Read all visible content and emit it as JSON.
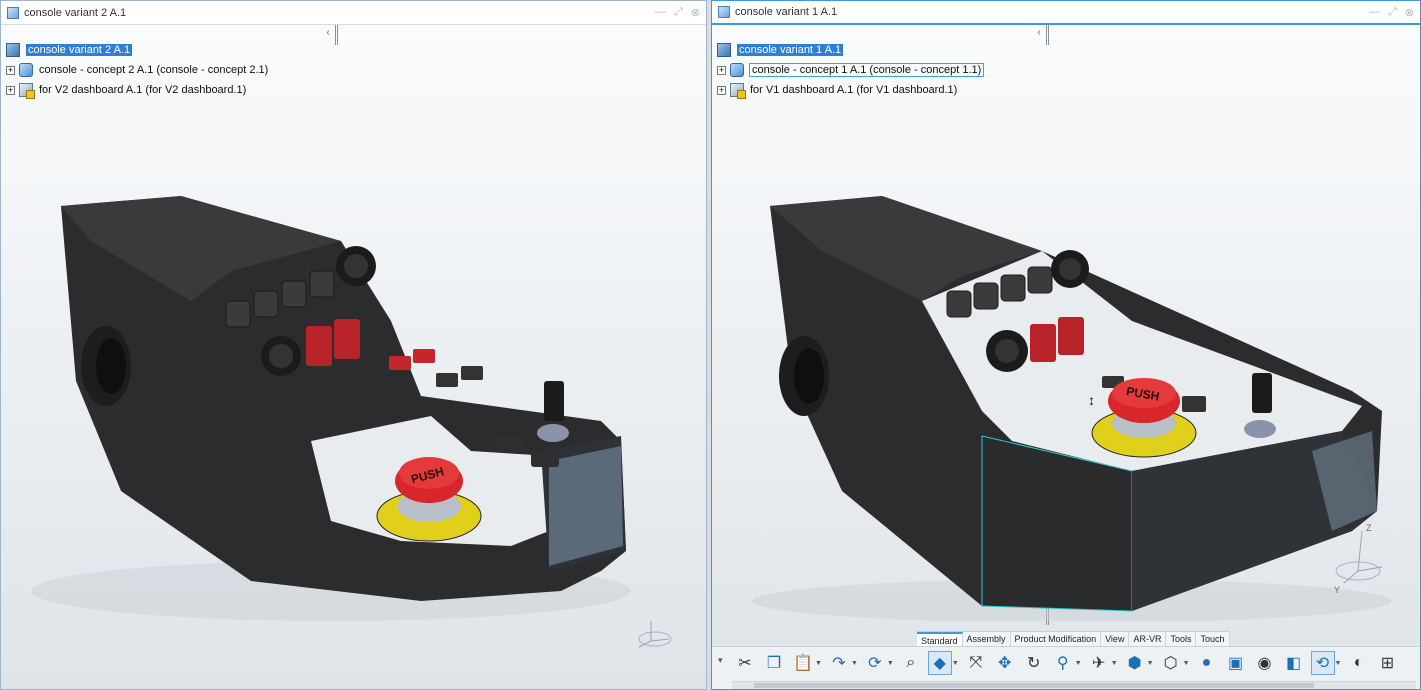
{
  "windows": {
    "left": {
      "title": "console variant 2 A.1",
      "tree": {
        "root": "console variant 2 A.1",
        "children": [
          "console - concept 2 A.1 (console - concept 2.1)",
          "for V2 dashboard A.1 (for V2 dashboard.1)"
        ]
      },
      "button_labels": [
        "PUSH"
      ]
    },
    "right": {
      "title": "console variant 1 A.1",
      "tree": {
        "root": "console variant 1 A.1",
        "children": [
          "console - concept 1 A.1 (console - concept 1.1)",
          "for V1 dashboard A.1 (for V1 dashboard.1)"
        ]
      },
      "button_labels": [
        "PUSH"
      ],
      "toolbar_tabs": [
        "Standard",
        "Assembly",
        "Product Modification",
        "View",
        "AR-VR",
        "Tools",
        "Touch"
      ],
      "active_tab": "Standard",
      "compass_labels": {
        "z": "Z",
        "y": "Y"
      }
    }
  },
  "window_controls": {
    "minimize": "—",
    "maximize": "⤢",
    "close": "⊗"
  },
  "collapse_glyph": "‹",
  "expander_glyph": "+",
  "colors": {
    "selection": "#2f7fd8",
    "accent": "#3a9bd6",
    "console_body": "#2c2c2e",
    "estop_red": "#d8262a",
    "estop_yellow": "#e8d21a"
  },
  "icons": [
    "scissors-icon",
    "copy-icon",
    "paste-icon",
    "redo-icon",
    "update-icon",
    "zoom-icon",
    "cube-view-icon",
    "fit-all-icon",
    "pan-icon",
    "rotate-icon",
    "zoom-area-icon",
    "fly-icon",
    "normal-view-icon",
    "iso-view-icon",
    "render-icon",
    "capture-icon",
    "hide-show-icon",
    "swap-visible-icon",
    "refresh-icon",
    "shading-icon",
    "multi-view-icon"
  ]
}
